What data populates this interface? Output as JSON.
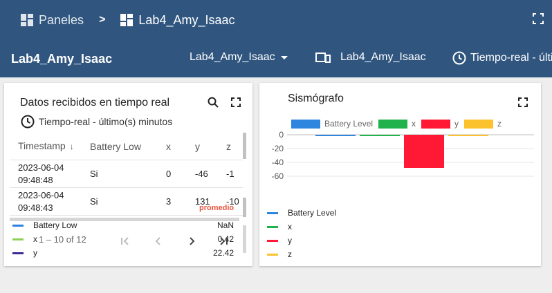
{
  "breadcrumb": {
    "root": "Paneles",
    "separator": ">",
    "current": "Lab4_Amy_Isaac"
  },
  "toolbar": {
    "dashboard_title": "Lab4_Amy_Isaac",
    "state_select": "Lab4_Amy_Isaac",
    "entity_alias": "Lab4_Amy_Isaac",
    "timewindow": "Tiempo-real - últim"
  },
  "table_widget": {
    "title": "Datos recibidos en tiempo real",
    "timewindow": "Tiempo-real - último(s) minutos",
    "columns": [
      "Timestamp",
      "Battery Low",
      "x",
      "y",
      "z"
    ],
    "rows": [
      {
        "date": "2023-06-04",
        "time": "09:48:48",
        "battery_low": "Si",
        "x": "0",
        "y": "-46",
        "z": "-1"
      },
      {
        "date": "2023-06-04",
        "time": "09:48:43",
        "battery_low": "Si",
        "x": "3",
        "y": "131",
        "z": "-10"
      }
    ],
    "overlay_label": "promedio",
    "legend": [
      {
        "name": "Battery Low",
        "value": "NaN",
        "color": "#2f7fe0"
      },
      {
        "name": "x",
        "value": "0.42",
        "color": "#8cd057"
      },
      {
        "name": "y",
        "value": "22.42",
        "color": "#3b2a9a"
      }
    ],
    "paginator": {
      "range": "1 – 10 of 12"
    }
  },
  "chart_widget": {
    "title": "Sismógrafo"
  },
  "chart_data": {
    "type": "bar",
    "series": [
      {
        "name": "Battery Level",
        "color": "#2e86de",
        "value": -0.5
      },
      {
        "name": "x",
        "color": "#21b24c",
        "value": -0.5
      },
      {
        "name": "y",
        "color": "#ff1935",
        "value": -48
      },
      {
        "name": "z",
        "color": "#fcc22d",
        "value": -1
      }
    ],
    "ylim": [
      -65,
      0
    ],
    "yticks": [
      0,
      -20,
      -40,
      -60
    ],
    "grid": true,
    "legend_position": "top"
  }
}
